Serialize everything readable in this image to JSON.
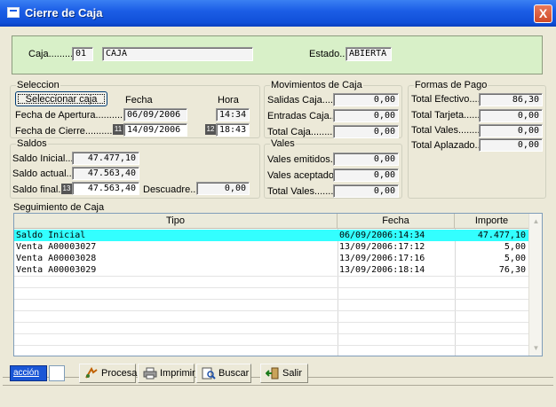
{
  "window": {
    "title": "Cierre de Caja",
    "close_glyph": "X"
  },
  "header": {
    "caja_label": "Caja.........",
    "caja_code": "01",
    "caja_name": "CAJA",
    "estado_label": "Estado....",
    "estado_value": "ABIERTA"
  },
  "seleccion": {
    "title": "Seleccion",
    "select_button": "Seleccionar caja",
    "fecha_header": "Fecha",
    "hora_header": "Hora",
    "apertura_label": "Fecha de Apertura.............",
    "apertura_fecha": "06/09/2006",
    "apertura_hora": "14:34",
    "cierre_label": "Fecha de Cierre..............",
    "cierre_badge": "11",
    "cierre_fecha": "14/09/2006",
    "hora_badge": "12",
    "cierre_hora": "18:43"
  },
  "saldos": {
    "title": "Saldos",
    "inicial_label": "Saldo Inicial....",
    "inicial_value": "47.477,10",
    "actual_label": "Saldo actual....",
    "actual_value": "47.563,40",
    "final_label": "Saldo final..",
    "final_badge": "13",
    "final_value": "47.563,40",
    "descuadre_label": "Descuadre..",
    "descuadre_value": "0,00"
  },
  "movimientos": {
    "title": "Movimientos de Caja",
    "salidas_label": "Salidas Caja.........",
    "salidas_value": "0,00",
    "entradas_label": "Entradas Caja......",
    "entradas_value": "0,00",
    "total_label": "Total Caja.............",
    "total_value": "0,00"
  },
  "vales": {
    "title": "Vales",
    "emitidos_label": "Vales emitidos.......",
    "emitidos_value": "0,00",
    "aceptados_label": "Vales aceptados..",
    "aceptados_value": "0,00",
    "total_label": "Total Vales...........",
    "total_value": "0,00"
  },
  "formas_pago": {
    "title": "Formas de Pago",
    "efectivo_label": "Total Efectivo.......",
    "efectivo_value": "86,30",
    "tarjeta_label": "Total Tarjeta.........",
    "tarjeta_value": "0,00",
    "vales_label": "Total Vales...........",
    "vales_value": "0,00",
    "aplazado_label": "Total Aplazado.......",
    "aplazado_value": "0,00"
  },
  "seguimiento": {
    "title": "Seguimiento de Caja",
    "columns": [
      "Tipo",
      "Fecha",
      "Importe"
    ],
    "rows": [
      {
        "tipo": "Saldo Inicial",
        "fecha": "06/09/2006:14:34",
        "importe": "47.477,10"
      },
      {
        "tipo": "Venta A00003027",
        "fecha": "13/09/2006:17:12",
        "importe": "5,00"
      },
      {
        "tipo": "Venta A00003028",
        "fecha": "13/09/2006:17:16",
        "importe": "5,00"
      },
      {
        "tipo": "Venta A00003029",
        "fecha": "13/09/2006:18:14",
        "importe": "76,30"
      }
    ]
  },
  "toolbar": {
    "accion_label": "acción",
    "procesar": "Procesar",
    "imprimir": "Imprimir",
    "buscar": "Buscar",
    "salir": "Salir"
  },
  "colors": {
    "highlight_row": "#33ffff",
    "header_panel": "#d8f0c8",
    "titlebar": "#1c5ee6"
  }
}
